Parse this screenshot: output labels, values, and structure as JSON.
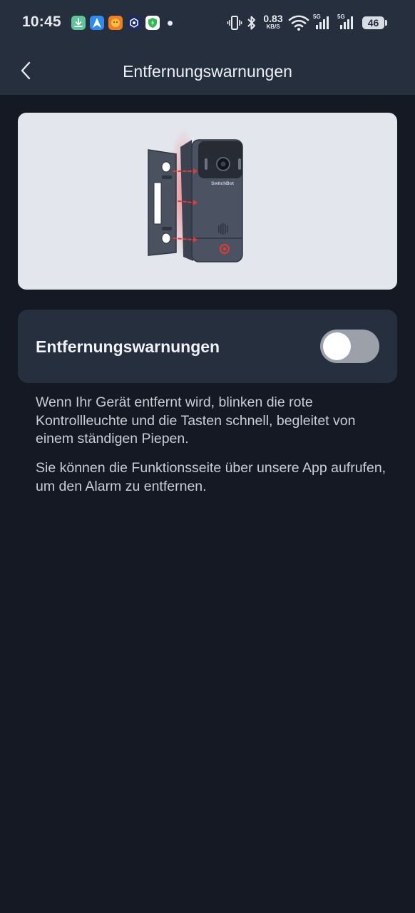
{
  "status_bar": {
    "time": "10:45",
    "net_speed_value": "0.83",
    "net_speed_unit": "KB/S",
    "signal_1_label": "5G",
    "signal_2_label": "5G",
    "battery_level": "46",
    "icons": [
      "download-app-icon",
      "navigation-app-icon",
      "lion-app-icon",
      "crypto-app-icon",
      "shield-app-icon",
      "notification-dot",
      "vibrate-icon",
      "bluetooth-icon",
      "wifi-icon",
      "signal-icon",
      "signal-icon",
      "battery-icon"
    ]
  },
  "header": {
    "title": "Entfernungswarnungen",
    "back_icon": "chevron-left-icon"
  },
  "illustration": {
    "brand_text": "SwitchBot",
    "accent_color": "#e03a3a"
  },
  "setting": {
    "label": "Entfernungswarnungen",
    "toggle_on": false
  },
  "descriptions": {
    "text1": "Wenn Ihr Gerät entfernt wird, blinken die rote Kontrollleuchte und die Tasten schnell, begleitet von einem ständigen Piepen.",
    "text2": "Sie können die Funktionsseite über unsere App aufrufen, um den Alarm zu entfernen."
  },
  "colors": {
    "background": "#141924",
    "header": "#262f3e",
    "card": "#262f3e",
    "image_card": "#e3e6ec",
    "toggle_off": "#9ca0a8"
  }
}
